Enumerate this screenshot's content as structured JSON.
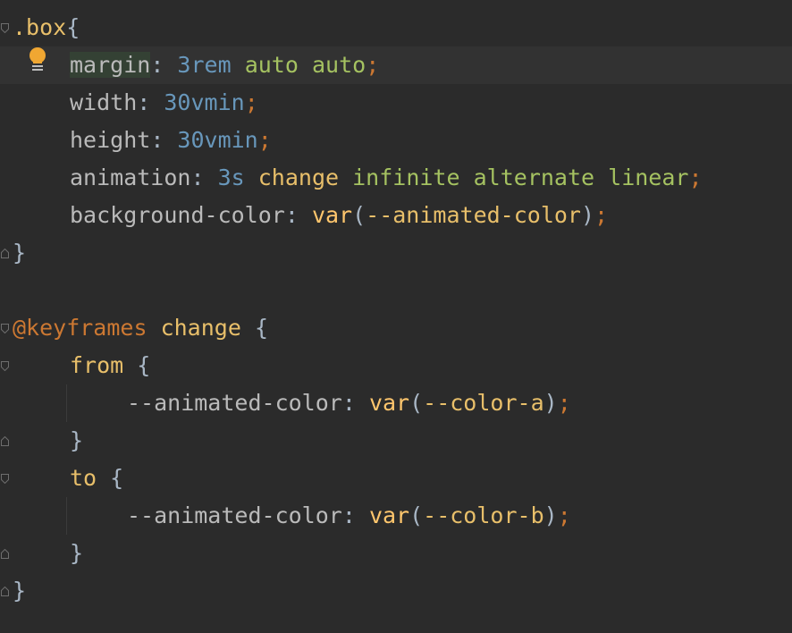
{
  "editor": {
    "lines": [
      {
        "tokens": [
          {
            "t": ".box",
            "c": "tk-sel"
          },
          {
            "t": "{",
            "c": "tk-punct"
          }
        ]
      },
      {
        "tokens": [
          {
            "t": "margin",
            "c": "tk-prop-hl"
          },
          {
            "t": ": ",
            "c": "tk-punct"
          },
          {
            "t": "3rem",
            "c": "tk-num"
          },
          {
            "t": " ",
            "c": "tk-punct"
          },
          {
            "t": "auto",
            "c": "tk-val"
          },
          {
            "t": " ",
            "c": "tk-punct"
          },
          {
            "t": "auto",
            "c": "tk-val"
          },
          {
            "t": ";",
            "c": "tk-semi"
          }
        ]
      },
      {
        "tokens": [
          {
            "t": "width",
            "c": "tk-prop"
          },
          {
            "t": ": ",
            "c": "tk-punct"
          },
          {
            "t": "30vmin",
            "c": "tk-num"
          },
          {
            "t": ";",
            "c": "tk-semi"
          }
        ]
      },
      {
        "tokens": [
          {
            "t": "height",
            "c": "tk-prop"
          },
          {
            "t": ": ",
            "c": "tk-punct"
          },
          {
            "t": "30vmin",
            "c": "tk-num"
          },
          {
            "t": ";",
            "c": "tk-semi"
          }
        ]
      },
      {
        "tokens": [
          {
            "t": "animation",
            "c": "tk-prop"
          },
          {
            "t": ": ",
            "c": "tk-punct"
          },
          {
            "t": "3s",
            "c": "tk-num"
          },
          {
            "t": " ",
            "c": "tk-punct"
          },
          {
            "t": "change",
            "c": "tk-anim"
          },
          {
            "t": " ",
            "c": "tk-punct"
          },
          {
            "t": "infinite",
            "c": "tk-val"
          },
          {
            "t": " ",
            "c": "tk-punct"
          },
          {
            "t": "alternate",
            "c": "tk-val"
          },
          {
            "t": " ",
            "c": "tk-punct"
          },
          {
            "t": "linear",
            "c": "tk-val"
          },
          {
            "t": ";",
            "c": "tk-semi"
          }
        ]
      },
      {
        "tokens": [
          {
            "t": "background-color",
            "c": "tk-prop"
          },
          {
            "t": ": ",
            "c": "tk-punct"
          },
          {
            "t": "var",
            "c": "tk-func"
          },
          {
            "t": "(",
            "c": "tk-punct"
          },
          {
            "t": "--animated-color",
            "c": "tk-anim"
          },
          {
            "t": ")",
            "c": "tk-punct"
          },
          {
            "t": ";",
            "c": "tk-semi"
          }
        ]
      },
      {
        "tokens": [
          {
            "t": "}",
            "c": "tk-punct"
          }
        ]
      },
      {
        "tokens": []
      },
      {
        "tokens": [
          {
            "t": "@keyframes",
            "c": "tk-kw"
          },
          {
            "t": " ",
            "c": "tk-punct"
          },
          {
            "t": "change",
            "c": "tk-anim"
          },
          {
            "t": " {",
            "c": "tk-punct"
          }
        ]
      },
      {
        "tokens": [
          {
            "t": "from",
            "c": "tk-anim"
          },
          {
            "t": " {",
            "c": "tk-punct"
          }
        ]
      },
      {
        "tokens": [
          {
            "t": "--animated-color",
            "c": "tk-var"
          },
          {
            "t": ": ",
            "c": "tk-punct"
          },
          {
            "t": "var",
            "c": "tk-func"
          },
          {
            "t": "(",
            "c": "tk-punct"
          },
          {
            "t": "--color-a",
            "c": "tk-anim"
          },
          {
            "t": ")",
            "c": "tk-punct"
          },
          {
            "t": ";",
            "c": "tk-semi"
          }
        ]
      },
      {
        "tokens": [
          {
            "t": "}",
            "c": "tk-punct"
          }
        ]
      },
      {
        "tokens": [
          {
            "t": "to",
            "c": "tk-anim"
          },
          {
            "t": " {",
            "c": "tk-punct"
          }
        ]
      },
      {
        "tokens": [
          {
            "t": "--animated-color",
            "c": "tk-var"
          },
          {
            "t": ": ",
            "c": "tk-punct"
          },
          {
            "t": "var",
            "c": "tk-func"
          },
          {
            "t": "(",
            "c": "tk-punct"
          },
          {
            "t": "--color-b",
            "c": "tk-anim"
          },
          {
            "t": ")",
            "c": "tk-punct"
          },
          {
            "t": ";",
            "c": "tk-semi"
          }
        ]
      },
      {
        "tokens": [
          {
            "t": "}",
            "c": "tk-punct"
          }
        ]
      },
      {
        "tokens": [
          {
            "t": "}",
            "c": "tk-punct"
          }
        ]
      }
    ],
    "current_line": 1,
    "intention_icon": "lightbulb-icon",
    "colors": {
      "background": "#2b2b2b",
      "selector": "#e8bf6a",
      "number": "#6897bb",
      "value": "#a5c261",
      "semicolon": "#cc7832",
      "function": "#ffc66d",
      "bulb": "#f0a732"
    }
  }
}
